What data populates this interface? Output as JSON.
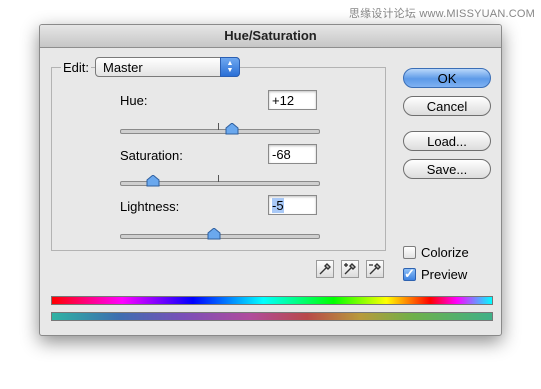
{
  "watermark": "思缘设计论坛 www.MISSYUAN.COM",
  "dialog": {
    "title": "Hue/Saturation",
    "edit_label": "Edit:",
    "edit_value": "Master",
    "sliders": [
      {
        "label": "Hue:",
        "value": "+12",
        "slider_fraction": 0.56
      },
      {
        "label": "Saturation:",
        "value": "-68",
        "slider_fraction": 0.16
      },
      {
        "label": "Lightness:",
        "value": "-5",
        "slider_fraction": 0.47
      }
    ],
    "buttons": {
      "ok": "OK",
      "cancel": "Cancel",
      "load": "Load...",
      "save": "Save..."
    },
    "checkboxes": [
      {
        "label": "Colorize",
        "checked": false
      },
      {
        "label": "Preview",
        "checked": true
      }
    ],
    "eyedroppers": [
      "eyedropper-icon",
      "eyedropper-plus-icon",
      "eyedropper-minus-icon"
    ]
  },
  "colors": {
    "accent": "#5d9ae8",
    "selection": "#a9c9f7"
  }
}
